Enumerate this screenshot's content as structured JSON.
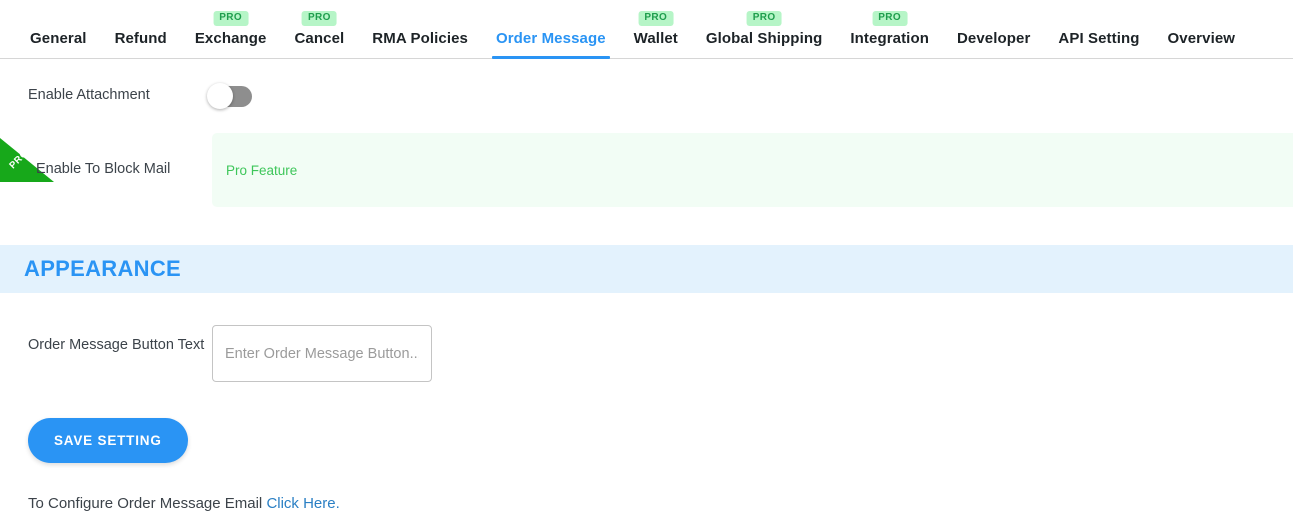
{
  "tabs": [
    {
      "label": "General",
      "pro": false,
      "active": false
    },
    {
      "label": "Refund",
      "pro": false,
      "active": false
    },
    {
      "label": "Exchange",
      "pro": true,
      "active": false,
      "badge": "PRO"
    },
    {
      "label": "Cancel",
      "pro": true,
      "active": false,
      "badge": "PRO"
    },
    {
      "label": "RMA Policies",
      "pro": false,
      "active": false
    },
    {
      "label": "Order Message",
      "pro": false,
      "active": true
    },
    {
      "label": "Wallet",
      "pro": true,
      "active": false,
      "badge": "PRO"
    },
    {
      "label": "Global Shipping",
      "pro": true,
      "active": false,
      "badge": "PRO"
    },
    {
      "label": "Integration",
      "pro": true,
      "active": false,
      "badge": "PRO"
    },
    {
      "label": "Developer",
      "pro": false,
      "active": false
    },
    {
      "label": "API Setting",
      "pro": false,
      "active": false
    },
    {
      "label": "Overview",
      "pro": false,
      "active": false
    }
  ],
  "settings": {
    "enable_attachment": {
      "label": "Enable Attachment",
      "toggle_state": "off"
    },
    "enable_block_mail": {
      "label": "Enable To Block Mail",
      "pro_feature_text": "Pro Feature",
      "ribbon_text": "PRO"
    }
  },
  "appearance": {
    "title": "APPEARANCE",
    "order_message_button_text": {
      "label": "Order Message Button Text",
      "value": "",
      "placeholder": "Enter Order Message Button..."
    }
  },
  "actions": {
    "save_label": "SAVE SETTING"
  },
  "footer": {
    "text": "To Configure Order Message Email ",
    "link_text": "Click Here.",
    "full": "To Configure Order Message Email Click Here."
  },
  "colors": {
    "accent_blue": "#2a94f4",
    "appearance_band": "#e3f2fd",
    "pro_badge_bg": "#b6f5c7",
    "pro_badge_text": "#1f9d4d",
    "pro_band_bg": "#f2fdf5",
    "pro_band_text": "#3ec65a",
    "ribbon_green": "#17a81a",
    "toggle_off": "#8e8e8e"
  }
}
